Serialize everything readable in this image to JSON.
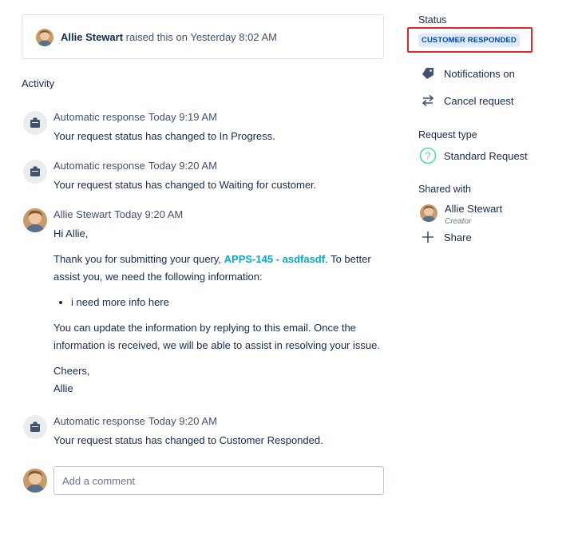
{
  "raised": {
    "author": "Allie Stewart",
    "text": " raised this on Yesterday 8:02 AM"
  },
  "activity": {
    "heading": "Activity",
    "entries": [
      {
        "author": "Automatic response",
        "time": "Today 9:19 AM",
        "text": "Your request status has changed to In Progress."
      },
      {
        "author": "Automatic response",
        "time": "Today 9:20 AM",
        "text": "Your request status has changed to Waiting for customer."
      },
      {
        "author": "Allie Stewart",
        "time": "Today 9:20 AM",
        "greeting": "Hi Allie,",
        "para1_before": "Thank you for submitting your query, ",
        "para1_link": "APPS-145 - asdfasdf",
        "para1_after": ". To better",
        "para1_line2": "assist you, we need the following information:",
        "bullet": "i need more info here",
        "para2_line1": "You can update the information by replying to this email. Once the",
        "para2_line2": "information is received, we will be able to assist in resolving your issue.",
        "signoff": "Cheers,",
        "signature": "Allie"
      },
      {
        "author": "Automatic response",
        "time": "Today 9:20 AM",
        "text": "Your request status has changed to Customer Responded."
      }
    ]
  },
  "comment": {
    "placeholder": "Add a comment"
  },
  "sidebar": {
    "status_label": "Status",
    "status_value": "CUSTOMER RESPONDED",
    "status_color": "#deebff",
    "highlight_color": "#e3242b",
    "notifications": "Notifications on",
    "cancel": "Cancel request",
    "request_type_label": "Request type",
    "request_type": "Standard Request",
    "shared_with_label": "Shared with",
    "shared_user": "Allie Stewart",
    "shared_role": "Creator",
    "share": "Share"
  },
  "icons": {
    "avatar": "user-avatar",
    "automatic": "bot-icon",
    "notifications": "tag-icon",
    "cancel": "swap-arrows-icon",
    "request_type": "question-circle-icon",
    "share": "plus-icon"
  }
}
